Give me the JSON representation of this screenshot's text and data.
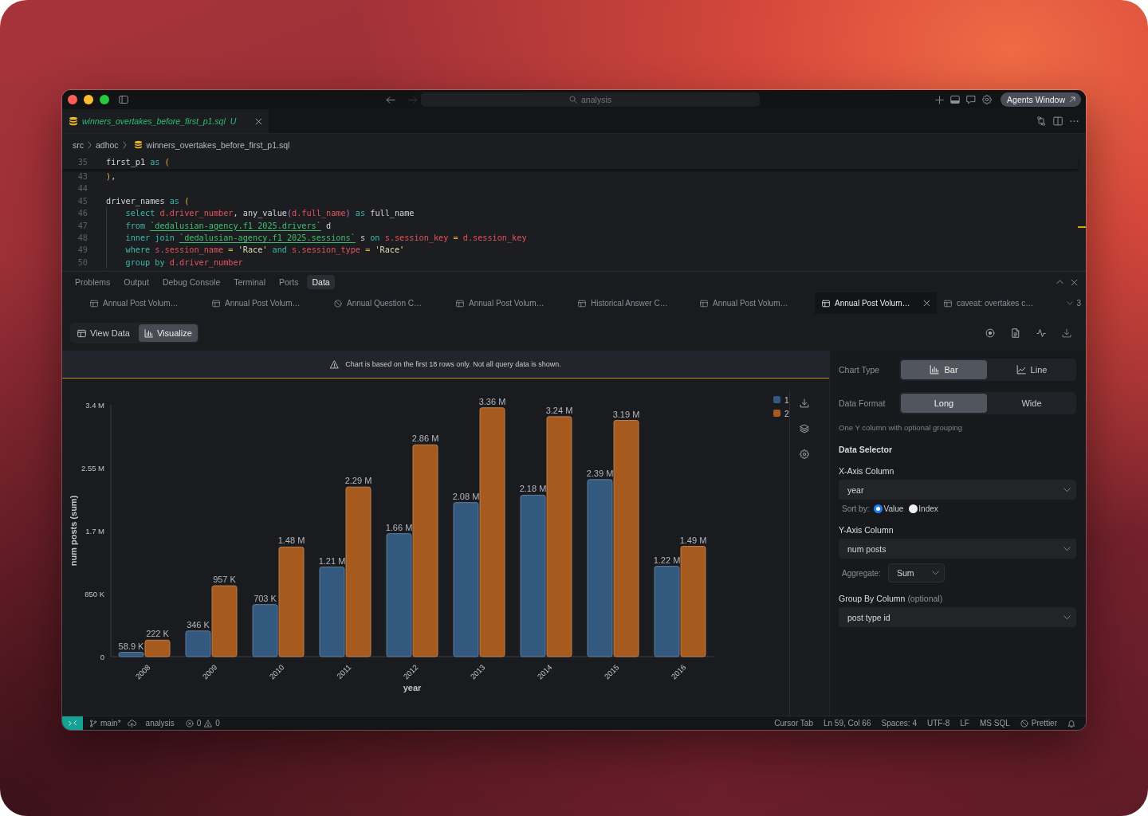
{
  "title_bar": {
    "back_disabled": false,
    "forward_disabled": true,
    "command_center": "analysis",
    "agents_button": "Agents Window"
  },
  "editor_tabs": [
    {
      "label": "winners_overtakes_before_first_p1.sql",
      "status": "U",
      "kind": "untracked",
      "preview": true,
      "selected": true
    }
  ],
  "breadcrumb": [
    {
      "label": "src",
      "kind": "folder"
    },
    {
      "label": "adhoc",
      "kind": "folder"
    },
    {
      "label": "winners_overtakes_before_first_p1.sql",
      "kind": "sql_file"
    }
  ],
  "code": {
    "sticky": [
      {
        "number": "35",
        "tokens": [
          {
            "kind": "plain",
            "text": "first_p1 "
          },
          {
            "kind": "keyword",
            "text": "as"
          },
          {
            "kind": "punct",
            "text": " ("
          }
        ]
      }
    ],
    "lines": [
      {
        "number": "43",
        "tokens": [
          {
            "kind": "punct",
            "text": ")"
          },
          {
            "kind": "plain",
            "text": ","
          }
        ]
      },
      {
        "number": "44"
      },
      {
        "number": "45",
        "tokens": [
          {
            "kind": "plain",
            "text": "driver_names "
          },
          {
            "kind": "keyword",
            "text": "as"
          },
          {
            "kind": "punct",
            "text": " ("
          }
        ],
        "children": [
          {
            "number": "46",
            "tokens": [
              {
                "kind": "keyword",
                "text": "select"
              },
              {
                "kind": "ref",
                "text": " d.driver_number"
              },
              {
                "kind": "plain",
                "text": ", any_value"
              },
              {
                "kind": "call",
                "text": "("
              },
              {
                "kind": "ref",
                "text": "d.full_name"
              },
              {
                "kind": "call",
                "text": ")"
              },
              {
                "kind": "keyword",
                "text": " as"
              },
              {
                "kind": "plain",
                "text": " full_name"
              }
            ]
          },
          {
            "number": "47",
            "tokens": [
              {
                "kind": "keyword",
                "text": "from "
              },
              {
                "kind": "quoted",
                "text": "`dedalusian-agency.f1_2025.drivers`"
              },
              {
                "kind": "plain",
                "text": " d"
              }
            ]
          },
          {
            "number": "48",
            "tokens": [
              {
                "kind": "keyword",
                "text": "inner join "
              },
              {
                "kind": "quoted",
                "text": "`dedalusian-agency.f1_2025.sessions`"
              },
              {
                "kind": "plain",
                "text": " s "
              },
              {
                "kind": "keyword",
                "text": "on"
              },
              {
                "kind": "ref",
                "text": " s.session_key"
              },
              {
                "kind": "punct",
                "text": " ="
              },
              {
                "kind": "ref",
                "text": " d.session_key"
              }
            ]
          },
          {
            "number": "49",
            "tokens": [
              {
                "kind": "keyword",
                "text": "where"
              },
              {
                "kind": "ref",
                "text": " s.session_name"
              },
              {
                "kind": "punct",
                "text": " ="
              },
              {
                "kind": "string",
                "text": " 'Race'"
              },
              {
                "kind": "keyword",
                "text": " and"
              },
              {
                "kind": "ref",
                "text": " s.session_type"
              },
              {
                "kind": "punct",
                "text": " ="
              },
              {
                "kind": "string",
                "text": " 'Race'"
              }
            ]
          },
          {
            "number": "50",
            "tokens": [
              {
                "kind": "keyword",
                "text": "group by"
              },
              {
                "kind": "ref",
                "text": " d.driver_number"
              }
            ]
          }
        ]
      }
    ]
  },
  "panel": {
    "tabs": [
      {
        "label": "Problems",
        "selected": false
      },
      {
        "label": "Output",
        "selected": false
      },
      {
        "label": "Debug Console",
        "selected": false
      },
      {
        "label": "Terminal",
        "selected": false
      },
      {
        "label": "Ports",
        "selected": false
      },
      {
        "label": "Data",
        "selected": true
      }
    ],
    "query_tabs": [
      {
        "label": "Annual Post Volum…",
        "kind": "table",
        "selected": false
      },
      {
        "label": "Annual Post Volum…",
        "kind": "table",
        "selected": false
      },
      {
        "label": "Annual Question C…",
        "kind": "blocked",
        "selected": false
      },
      {
        "label": "Annual Post Volum…",
        "kind": "table",
        "selected": false
      },
      {
        "label": "Historical Answer C…",
        "kind": "table",
        "selected": false
      },
      {
        "label": "Annual Post Volum…",
        "kind": "table",
        "selected": false
      },
      {
        "label": "Annual Post Volum…",
        "kind": "table",
        "selected": true
      },
      {
        "label": "caveat: overtakes c…",
        "kind": "table",
        "selected": false
      }
    ],
    "overflow_count": "3"
  },
  "toolbar": {
    "views": [
      {
        "label": "View Data",
        "selected": false
      },
      {
        "label": "Visualize",
        "selected": true
      }
    ]
  },
  "visualization": {
    "notice": "Chart is based on the first 18 rows only. Not all query data is shown.",
    "chart_data": [
      {
        "type": "bar",
        "xlabel": "year",
        "ylabel": "num posts (sum)",
        "categories": [
          "2008",
          "2009",
          "2010",
          "2011",
          "2012",
          "2013",
          "2014",
          "2015",
          "2016"
        ],
        "series": [
          {
            "name": "1",
            "color": "#34597f",
            "values": [
              58900,
              346000,
              703000,
              1210000,
              1660000,
              2080000,
              2180000,
              2390000,
              1220000
            ]
          },
          {
            "name": "2",
            "color": "#a75a1d",
            "values": [
              222000,
              957000,
              1480000,
              2290000,
              2860000,
              3360000,
              3240000,
              3190000,
              1490000
            ]
          }
        ],
        "value_labels": [
          [
            "58.9 K",
            "346 K",
            "703 K",
            "1.21 M",
            "1.66 M",
            "2.08 M",
            "2.18 M",
            "2.39 M",
            "1.22 M"
          ],
          [
            "222 K",
            "957 K",
            "1.48 M",
            "2.29 M",
            "2.86 M",
            "3.36 M",
            "3.24 M",
            "3.19 M",
            "1.49 M"
          ]
        ],
        "ylim": [
          0,
          3400000
        ],
        "yticks": [
          {
            "value": 0,
            "label": "0"
          },
          {
            "value": 850000,
            "label": "850 K"
          },
          {
            "value": 1700000,
            "label": "1.7 M"
          },
          {
            "value": 2550000,
            "label": "2.55 M"
          },
          {
            "value": 3400000,
            "label": "3.4 M"
          }
        ],
        "legend": "top-right"
      }
    ]
  },
  "settings": {
    "chart_type": {
      "label": "Chart Type",
      "options": [
        {
          "label": "Bar",
          "selected": true
        },
        {
          "label": "Line",
          "selected": false
        }
      ]
    },
    "data_format": {
      "label": "Data Format",
      "options": [
        {
          "label": "Long",
          "selected": true
        },
        {
          "label": "Wide",
          "selected": false
        }
      ]
    },
    "format_hint": "One Y column with optional grouping",
    "section_title": "Data Selector",
    "x_axis": {
      "label": "X-Axis Column",
      "value": "year"
    },
    "sort": {
      "label": "Sort by:",
      "options": [
        {
          "label": "Value",
          "selected": true
        },
        {
          "label": "Index",
          "selected": false
        }
      ]
    },
    "y_axis": {
      "label": "Y-Axis Column",
      "value": "num posts"
    },
    "aggregate": {
      "label": "Aggregate:",
      "value": "Sum"
    },
    "group_by": {
      "label": "Group By Column",
      "note": "(optional)",
      "value": "post type id"
    }
  },
  "status_bar": {
    "branch": "main*",
    "workspace": "analysis",
    "errors": "0",
    "warnings": "0",
    "items": [
      "Cursor Tab",
      "Ln 59, Col 66",
      "Spaces: 4",
      "UTF-8",
      "LF",
      "MS SQL"
    ],
    "formatter": "Prettier"
  }
}
